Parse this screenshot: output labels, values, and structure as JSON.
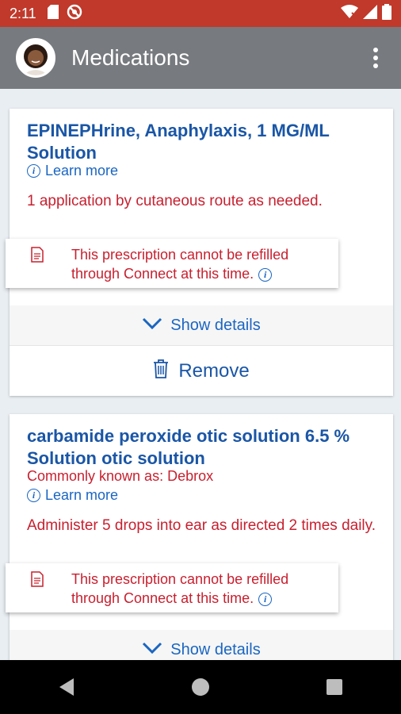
{
  "status_bar": {
    "time": "2:11",
    "left_icons": [
      "sd-card-icon",
      "no-disturb-icon"
    ],
    "right_icons": [
      "wifi-icon",
      "signal-icon",
      "battery-icon"
    ]
  },
  "app_bar": {
    "title": "Medications",
    "avatar_icon": "avatar",
    "menu_icon": "more-vert-icon"
  },
  "medications": [
    {
      "name": "EPINEPHrine, Anaphylaxis, 1 MG/ML Solution",
      "common_name": "",
      "learn_more": "Learn more",
      "sig": "1 application by cutaneous route as needed.",
      "refill_notice": "This prescription cannot be refilled through Connect at this time.",
      "show_details": "Show details",
      "remove": "Remove"
    },
    {
      "name": "carbamide peroxide otic solution 6.5 % Solution otic solution",
      "common_name": "Commonly known as: Debrox",
      "learn_more": "Learn more",
      "sig": "Administer 5 drops into ear as directed 2 times daily.",
      "refill_notice": "This prescription cannot be refilled through Connect at this time.",
      "show_details": "Show details"
    }
  ],
  "nav_bar": {
    "icons": [
      "back-icon",
      "home-icon",
      "recents-icon"
    ]
  },
  "colors": {
    "status_bar": "#c0392b",
    "app_bar": "#777a7e",
    "drug_name": "#1a56a6",
    "warning_text": "#c8202f",
    "link": "#1a66c2"
  }
}
